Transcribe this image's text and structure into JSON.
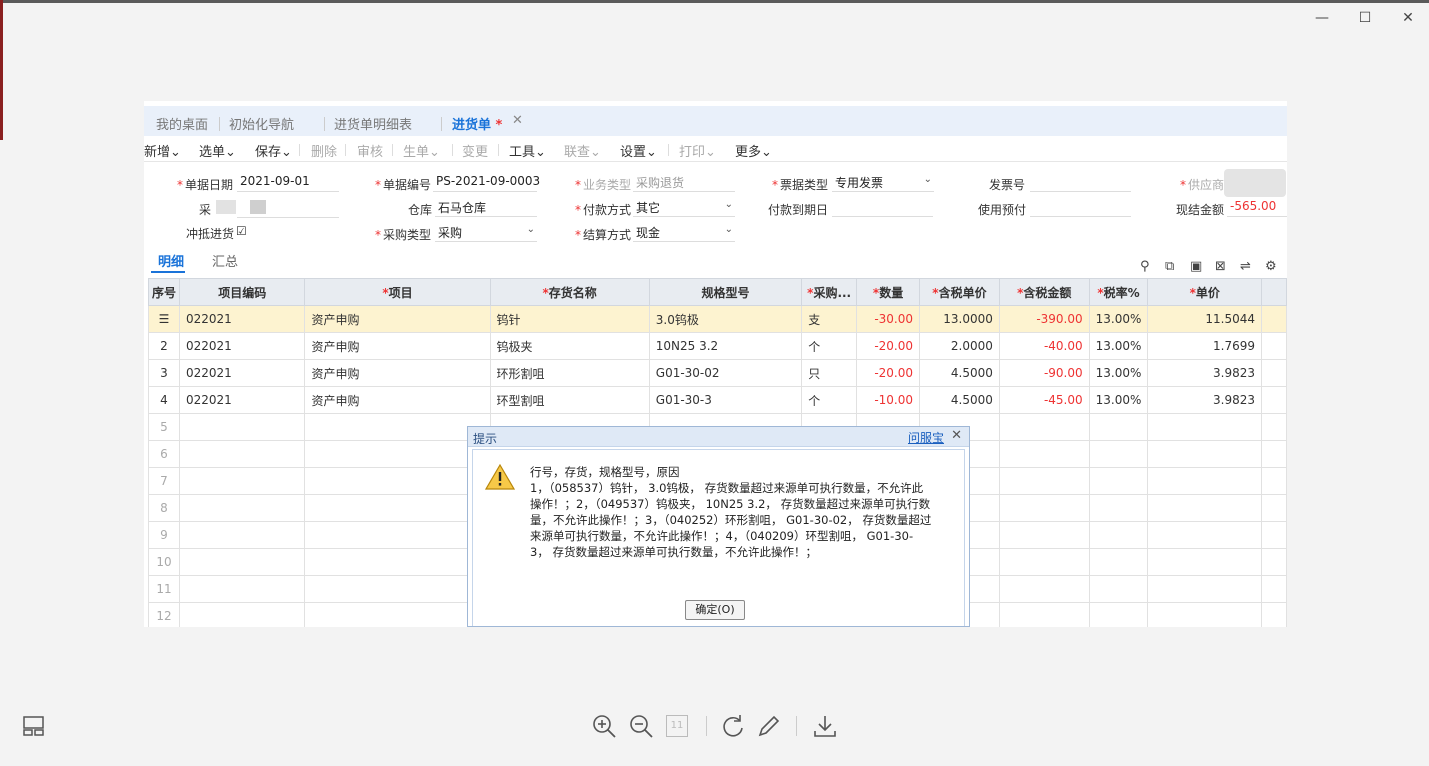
{
  "window": {
    "minimize": "—",
    "maximize": "☐",
    "close": "✕"
  },
  "tabs": [
    "我的桌面",
    "初始化导航",
    "进货单明细表",
    "进货单"
  ],
  "active_tab_mark": "*",
  "active_tab_close": "✕",
  "toolbar": [
    "新增",
    "选单",
    "保存",
    "删除",
    "审核",
    "生单",
    "变更",
    "工具",
    "联查",
    "设置",
    "打印",
    "更多"
  ],
  "form": {
    "doc_date_label": "单据日期",
    "doc_date": "2021-09-01",
    "doc_no_label": "单据编号",
    "doc_no": "PS-2021-09-0003",
    "biz_type_label": "业务类型",
    "biz_type": "采购退货",
    "invoice_type_label": "票据类型",
    "invoice_type": "专用发票",
    "invoice_no_label": "发票号",
    "invoice_no": "",
    "supplier_label": "供应商",
    "buyer_label": "采",
    "warehouse_label": "仓库",
    "warehouse": "石马仓库",
    "pay_method_label": "付款方式",
    "pay_method": "其它",
    "pay_due_label": "付款到期日",
    "pay_due": "",
    "use_prepay_label": "使用预付",
    "use_prepay": "",
    "cash_amount_label": "现结金额",
    "cash_amount": "-565.00",
    "offset_label": "冲抵进货",
    "offset_check": "☑",
    "purchase_type_label": "采购类型",
    "purchase_type": "采购",
    "settle_label": "结算方式",
    "settle": "现金"
  },
  "subtabs": [
    "明细",
    "汇总"
  ],
  "grid_icons": [
    "⚲",
    "⧉",
    "▣",
    "⊠",
    "⇌",
    "⚙"
  ],
  "columns": [
    "序号",
    "项目编码",
    "项目",
    "存货名称",
    "规格型号",
    "采购...",
    "数量",
    "含税单价",
    "含税金额",
    "税率%",
    "单价"
  ],
  "required_cols": [
    2,
    3,
    5,
    6,
    7,
    8,
    9,
    10
  ],
  "rows": [
    {
      "idx": "☰",
      "code": "022021",
      "project": "资产申购",
      "name": "钨针",
      "spec": "3.0钨极",
      "unit": "支",
      "qty": "-30.00",
      "price": "13.0000",
      "amount": "-390.00",
      "rate": "13.00%",
      "unit_price": "11.5044"
    },
    {
      "idx": "2",
      "code": "022021",
      "project": "资产申购",
      "name": "钨极夹",
      "spec": "10N25 3.2",
      "unit": "个",
      "qty": "-20.00",
      "price": "2.0000",
      "amount": "-40.00",
      "rate": "13.00%",
      "unit_price": "1.7699"
    },
    {
      "idx": "3",
      "code": "022021",
      "project": "资产申购",
      "name": "环形割咀",
      "spec": "G01-30-02",
      "unit": "只",
      "qty": "-20.00",
      "price": "4.5000",
      "amount": "-90.00",
      "rate": "13.00%",
      "unit_price": "3.9823"
    },
    {
      "idx": "4",
      "code": "022021",
      "project": "资产申购",
      "name": "环型割咀",
      "spec": "G01-30-3",
      "unit": "个",
      "qty": "-10.00",
      "price": "4.5000",
      "amount": "-45.00",
      "rate": "13.00%",
      "unit_price": "3.9823"
    }
  ],
  "empty_rows": [
    "5",
    "6",
    "7",
    "8",
    "9",
    "10",
    "11",
    "12"
  ],
  "dialog": {
    "title": "提示",
    "help": "问服宝",
    "close": "✕",
    "message": "行号，存货，规格型号，原因\n1，（058537）钨针， 3.0钨极， 存货数量超过来源单可执行数量，不允许此\n操作！；2，（049537）钨极夹， 10N25 3.2， 存货数量超过来源单可执行数\n量，不允许此操作！；3，（040252）环形割咀， G01-30-02， 存货数量超过\n来源单可执行数量，不允许此操作！；4，（040209）环型割咀， G01-30-\n3， 存货数量超过来源单可执行数量，不允许此操作！；",
    "ok": "确定(O)"
  },
  "viewer_bar": {
    "page_box": "11"
  }
}
